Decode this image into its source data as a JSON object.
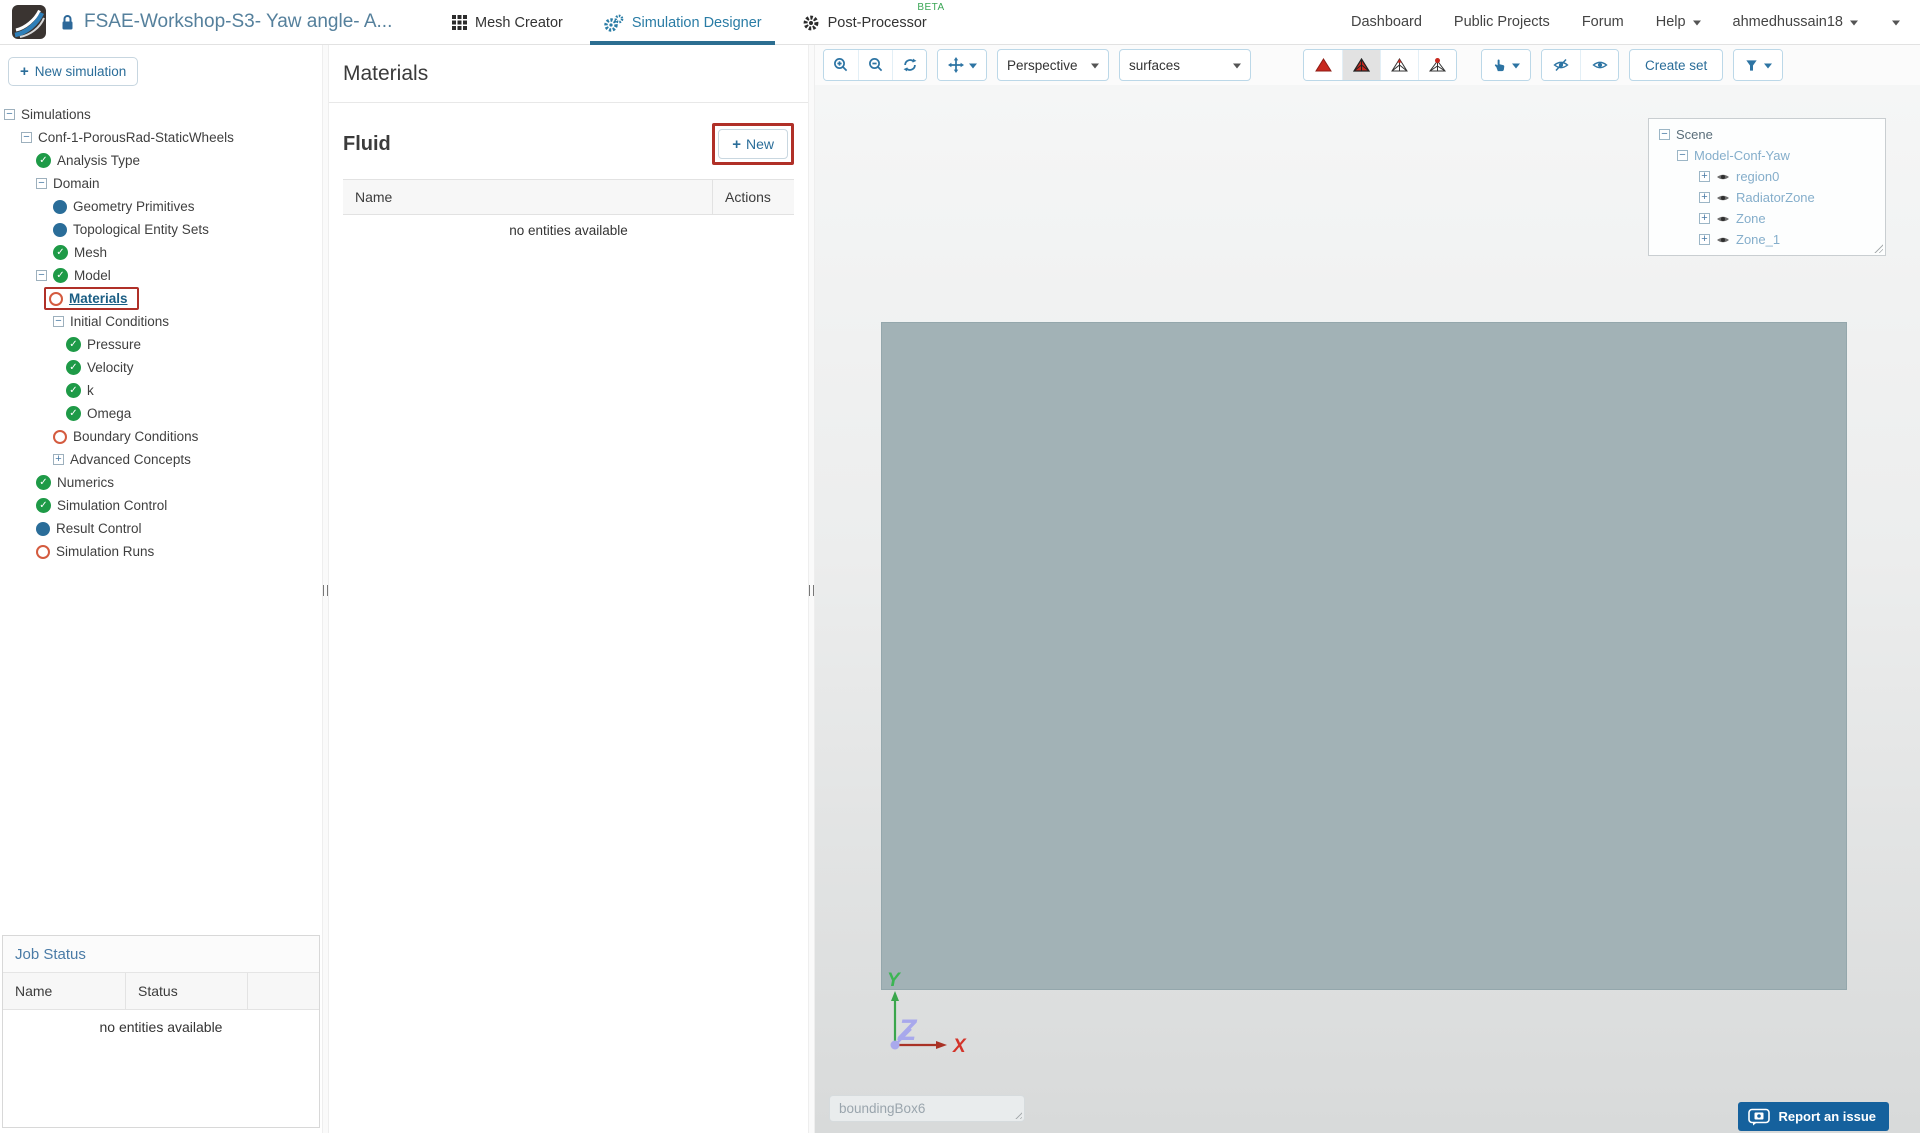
{
  "header": {
    "project_title": "FSAE-Workshop-S3- Yaw angle- A...",
    "tabs": [
      {
        "label": "Mesh Creator"
      },
      {
        "label": "Simulation Designer",
        "active": true
      },
      {
        "label": "Post-Processor",
        "badge": "BETA"
      }
    ],
    "nav": [
      "Dashboard",
      "Public Projects",
      "Forum",
      "Help",
      "ahmedhussain18"
    ]
  },
  "sidebar": {
    "new_simulation_label": "New simulation",
    "tree": [
      {
        "label": "Simulations"
      },
      {
        "label": "Conf-1-PorousRad-StaticWheels"
      },
      {
        "label": "Analysis Type",
        "status": "complete"
      },
      {
        "label": "Domain"
      },
      {
        "label": "Geometry Primitives",
        "status": "info"
      },
      {
        "label": "Topological Entity Sets",
        "status": "info"
      },
      {
        "label": "Mesh",
        "status": "complete"
      },
      {
        "label": "Model",
        "status": "complete"
      },
      {
        "label": "Materials",
        "status": "incomplete",
        "selected": true
      },
      {
        "label": "Initial Conditions"
      },
      {
        "label": "Pressure",
        "status": "complete"
      },
      {
        "label": "Velocity",
        "status": "complete"
      },
      {
        "label": "k",
        "status": "complete"
      },
      {
        "label": "Omega",
        "status": "complete"
      },
      {
        "label": "Boundary Conditions",
        "status": "incomplete"
      },
      {
        "label": "Advanced Concepts"
      },
      {
        "label": "Numerics",
        "status": "complete"
      },
      {
        "label": "Simulation Control",
        "status": "complete"
      },
      {
        "label": "Result Control",
        "status": "info"
      },
      {
        "label": "Simulation Runs",
        "status": "incomplete"
      }
    ]
  },
  "job_status": {
    "title": "Job Status",
    "columns": [
      "Name",
      "Status"
    ],
    "empty_text": "no entities available"
  },
  "materials": {
    "title": "Materials",
    "section_title": "Fluid",
    "new_button_label": "New",
    "table": {
      "columns": [
        "Name",
        "Actions"
      ],
      "empty_text": "no entities available"
    }
  },
  "viewport": {
    "toolbar": {
      "projection_select": "Perspective",
      "render_select": "surfaces",
      "create_set_label": "Create set"
    },
    "scene_tree": [
      {
        "label": "Scene"
      },
      {
        "label": "Model-Conf-Yaw"
      },
      {
        "label": "region0"
      },
      {
        "label": "RadiatorZone"
      },
      {
        "label": "Zone"
      },
      {
        "label": "Zone_1"
      }
    ],
    "axis": {
      "x": "X",
      "y": "Y",
      "z": "Z"
    },
    "bounding_box_placeholder": "boundingBox6",
    "report_button_label": "Report an issue"
  },
  "colors": {
    "accent_blue": "#2a6d99",
    "active_tab_blue": "#2c6e91",
    "check_green": "#1e9a47",
    "info_blue": "#2a6d99",
    "incomplete_orange": "#d45b3f",
    "annotation_red": "#b03028",
    "beta_green": "#3aa655",
    "viewport_box_gray": "#a2b2b6",
    "report_button_bg": "#15619d",
    "axis_x_red": "#d3342a",
    "axis_y_green": "#3aa64c",
    "axis_z_lavender": "#a8a8ec"
  }
}
